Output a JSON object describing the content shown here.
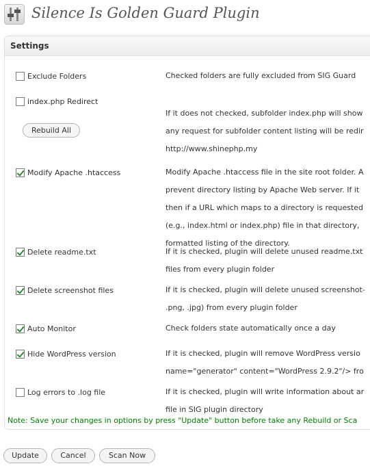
{
  "page": {
    "title": "Silence Is Golden Guard Plugin"
  },
  "panel": {
    "title": "Settings"
  },
  "options": [
    {
      "label": "Exclude Folders",
      "checked": false,
      "desc": [
        "Checked folders are fully excluded from SIG Guard"
      ]
    },
    {
      "label": "index.php Redirect",
      "checked": false,
      "desc": [
        "If it does not checked, subfolder index.php will show",
        "any request for subfolder content listing will be redir",
        "http://www.shinephp.my"
      ]
    },
    {
      "label": "Modify Apache .htaccess",
      "checked": true,
      "desc": [
        "Modify Apache .htaccess file in the site root folder. A",
        "prevent directory listing by Apache Web server. If it",
        "then if a URL which maps to a directory is requested",
        "(e.g., index.html or index.php) file in that directory,",
        "formatted listing of the directory."
      ]
    },
    {
      "label": "Delete readme.txt",
      "checked": true,
      "desc": [
        "If it is checked, plugin will delete unused readme.txt",
        "files from every plugin folder"
      ]
    },
    {
      "label": "Delete screenshot files",
      "checked": true,
      "desc": [
        "If it is checked, plugin will delete unused screenshot-",
        ".png, .jpg) from every plugin folder"
      ]
    },
    {
      "label": "Auto Monitor",
      "checked": true,
      "desc": [
        "Check folders state automatically once a day"
      ]
    },
    {
      "label": "Hide WordPress version",
      "checked": true,
      "desc": [
        "If it is checked, plugin will remove WordPress versio",
        "name=\"generator\" content=\"WordPress 2.9.2\"/> fro"
      ]
    },
    {
      "label": "Log errors to .log file",
      "checked": false,
      "desc": [
        "If it is checked, plugin will write information about ar",
        "file in SIG plugin directory"
      ]
    }
  ],
  "rebuild_label": "Rebuild All",
  "note": "Note: Save your changes in options by press \"Update\" button before take any Rebuild or Sca",
  "buttons": {
    "update": "Update",
    "cancel": "Cancel",
    "scan": "Scan Now"
  }
}
